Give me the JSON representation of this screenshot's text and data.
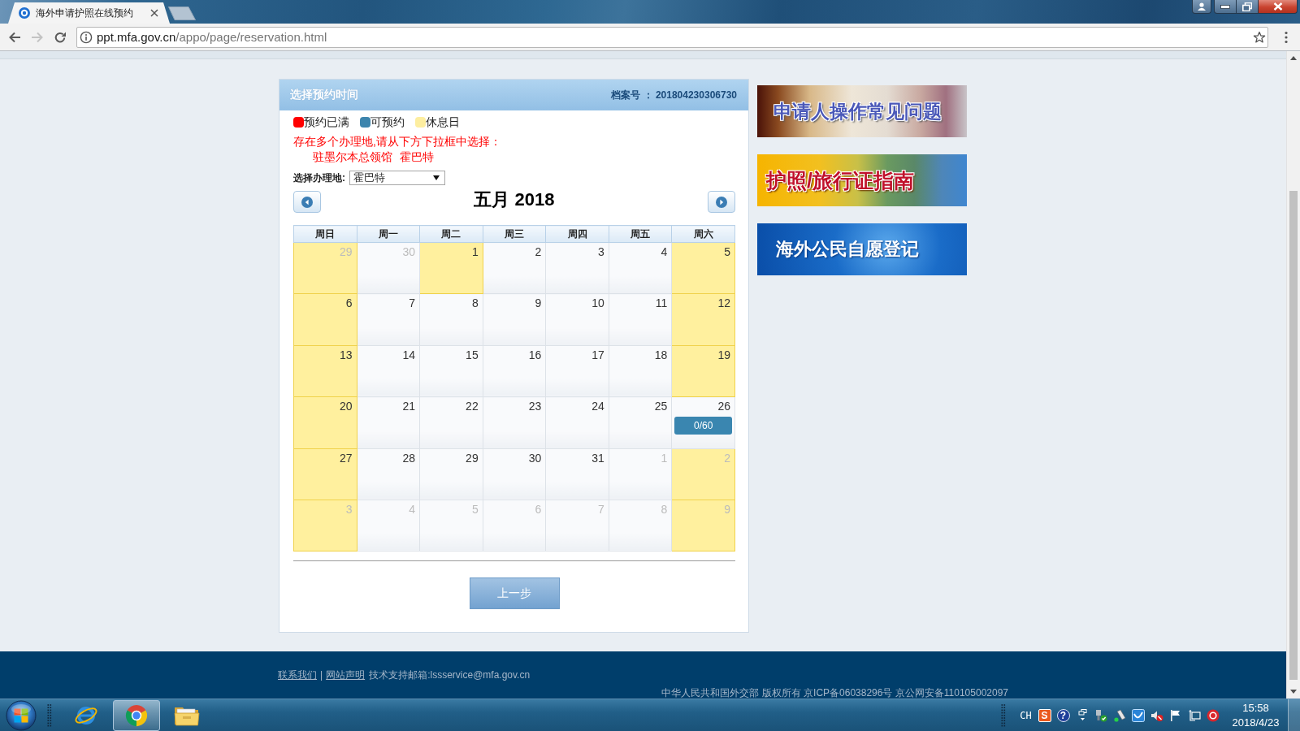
{
  "browser": {
    "tab_title": "海外申请护照在线预约",
    "back": {
      "disabled": false
    },
    "forward": {
      "disabled": true
    },
    "address_bar": {
      "host": "ppt.mfa.gov.cn",
      "path": "/appo/page/reservation.html"
    }
  },
  "panel": {
    "title": "选择预约时间",
    "file_number": "档案号 ： 201804230306730",
    "legend": [
      {
        "label": "预约已满",
        "color": "#ff0000"
      },
      {
        "label": "可预约",
        "color": "#3d85ad"
      },
      {
        "label": "休息日",
        "color": "#fdeea0"
      }
    ],
    "notice": "存在多个办理地,请从下方下拉框中选择：",
    "locations": [
      "驻墨尔本总领馆",
      "霍巴特"
    ],
    "location_select": {
      "label": "选择办理地:",
      "value": "霍巴特"
    },
    "month_title": "五月 2018",
    "weekdays": [
      "周日",
      "周一",
      "周二",
      "周三",
      "周四",
      "周五",
      "周六"
    ],
    "weeks": [
      [
        {
          "day": "29",
          "outside": true,
          "rest": true
        },
        {
          "day": "30",
          "outside": true,
          "rest": false
        },
        {
          "day": "1",
          "outside": false,
          "rest": true
        },
        {
          "day": "2",
          "outside": false,
          "rest": false
        },
        {
          "day": "3",
          "outside": false,
          "rest": false
        },
        {
          "day": "4",
          "outside": false,
          "rest": false
        },
        {
          "day": "5",
          "outside": false,
          "rest": true
        }
      ],
      [
        {
          "day": "6",
          "outside": false,
          "rest": true
        },
        {
          "day": "7",
          "outside": false,
          "rest": false
        },
        {
          "day": "8",
          "outside": false,
          "rest": false
        },
        {
          "day": "9",
          "outside": false,
          "rest": false
        },
        {
          "day": "10",
          "outside": false,
          "rest": false
        },
        {
          "day": "11",
          "outside": false,
          "rest": false
        },
        {
          "day": "12",
          "outside": false,
          "rest": true
        }
      ],
      [
        {
          "day": "13",
          "outside": false,
          "rest": true
        },
        {
          "day": "14",
          "outside": false,
          "rest": false
        },
        {
          "day": "15",
          "outside": false,
          "rest": false
        },
        {
          "day": "16",
          "outside": false,
          "rest": false
        },
        {
          "day": "17",
          "outside": false,
          "rest": false
        },
        {
          "day": "18",
          "outside": false,
          "rest": false
        },
        {
          "day": "19",
          "outside": false,
          "rest": true
        }
      ],
      [
        {
          "day": "20",
          "outside": false,
          "rest": true
        },
        {
          "day": "21",
          "outside": false,
          "rest": false
        },
        {
          "day": "22",
          "outside": false,
          "rest": false
        },
        {
          "day": "23",
          "outside": false,
          "rest": false
        },
        {
          "day": "24",
          "outside": false,
          "rest": false
        },
        {
          "day": "25",
          "outside": false,
          "rest": false
        },
        {
          "day": "26",
          "outside": false,
          "rest": false,
          "slots": {
            "text": "0/60",
            "full": false
          }
        }
      ],
      [
        {
          "day": "27",
          "outside": false,
          "rest": true
        },
        {
          "day": "28",
          "outside": false,
          "rest": false
        },
        {
          "day": "29",
          "outside": false,
          "rest": false
        },
        {
          "day": "30",
          "outside": false,
          "rest": false
        },
        {
          "day": "31",
          "outside": false,
          "rest": false
        },
        {
          "day": "1",
          "outside": true,
          "rest": false
        },
        {
          "day": "2",
          "outside": true,
          "rest": true
        }
      ],
      [
        {
          "day": "3",
          "outside": true,
          "rest": true
        },
        {
          "day": "4",
          "outside": true,
          "rest": false
        },
        {
          "day": "5",
          "outside": true,
          "rest": false
        },
        {
          "day": "6",
          "outside": true,
          "rest": false
        },
        {
          "day": "7",
          "outside": true,
          "rest": false
        },
        {
          "day": "8",
          "outside": true,
          "rest": false
        },
        {
          "day": "9",
          "outside": true,
          "rest": true
        }
      ]
    ],
    "back_button": "上一步"
  },
  "banners": [
    {
      "text": "申请人操作常见问题",
      "kind": "faq"
    },
    {
      "text": "护照/旅行证指南",
      "kind": "guide"
    },
    {
      "text": "海外公民自愿登记",
      "kind": "register"
    }
  ],
  "footer": {
    "links": [
      "联系我们",
      "网站声明"
    ],
    "separator": "|",
    "support": "技术支持邮箱:lssservice@mfa.gov.cn",
    "copyright": "中华人民共和国外交部 版权所有 京ICP备06038296号 京公网安备110105002097"
  },
  "taskbar": {
    "apps": [
      {
        "kind": "ie",
        "selected": false
      },
      {
        "kind": "chrome",
        "selected": true
      },
      {
        "kind": "folder",
        "selected": false
      }
    ],
    "language": "CH",
    "ime": "S",
    "help": "?",
    "time": "15:58",
    "date": "2018/4/23"
  }
}
